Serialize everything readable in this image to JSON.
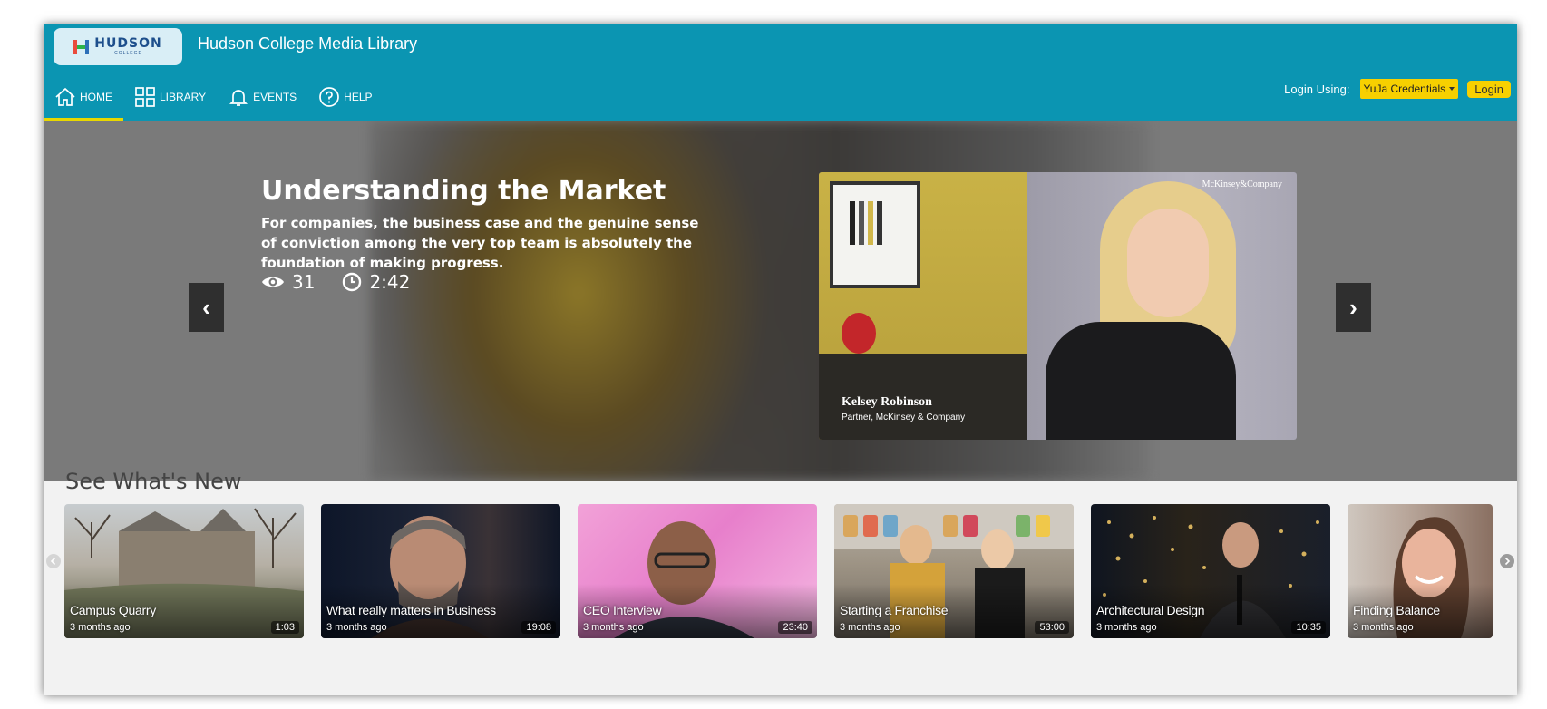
{
  "header": {
    "logo": {
      "text": "HUDSON",
      "subtext": "COLLEGE"
    },
    "site_title": "Hudson College Media Library",
    "nav": [
      {
        "label": "HOME",
        "icon": "home-icon",
        "active": true
      },
      {
        "label": "LIBRARY",
        "icon": "grid-icon",
        "active": false
      },
      {
        "label": "EVENTS",
        "icon": "bell-icon",
        "active": false
      },
      {
        "label": "HELP",
        "icon": "help-circle-icon",
        "active": false
      }
    ],
    "login_label": "Login Using:",
    "credentials_selected": "YuJa Credentials",
    "login_button": "Login"
  },
  "hero": {
    "title": "Understanding the Market",
    "description": "For companies, the business case and the genuine sense of conviction among the very top team is absolutely the foundation of making progress.",
    "views": "31",
    "duration": "2:42",
    "video": {
      "brand": "McKinsey&Company",
      "speaker_name": "Kelsey Robinson",
      "speaker_role": "Partner, McKinsey & Company"
    },
    "prev_label": "‹",
    "next_label": "›"
  },
  "whats_new": {
    "title": "See What's New",
    "items": [
      {
        "title": "Campus Quarry",
        "age": "3 months ago",
        "duration": "1:03"
      },
      {
        "title": "What really matters in Business",
        "age": "3 months ago",
        "duration": "19:08"
      },
      {
        "title": "CEO Interview",
        "age": "3 months ago",
        "duration": "23:40"
      },
      {
        "title": "Starting a Franchise",
        "age": "3 months ago",
        "duration": "53:00"
      },
      {
        "title": "Architectural Design",
        "age": "3 months ago",
        "duration": "10:35"
      },
      {
        "title": "Finding Balance",
        "age": "3 months ago",
        "duration": ""
      }
    ]
  },
  "colors": {
    "header_bg": "#0b95b2",
    "accent_yellow": "#f7d000",
    "active_underline": "#e8d800"
  }
}
